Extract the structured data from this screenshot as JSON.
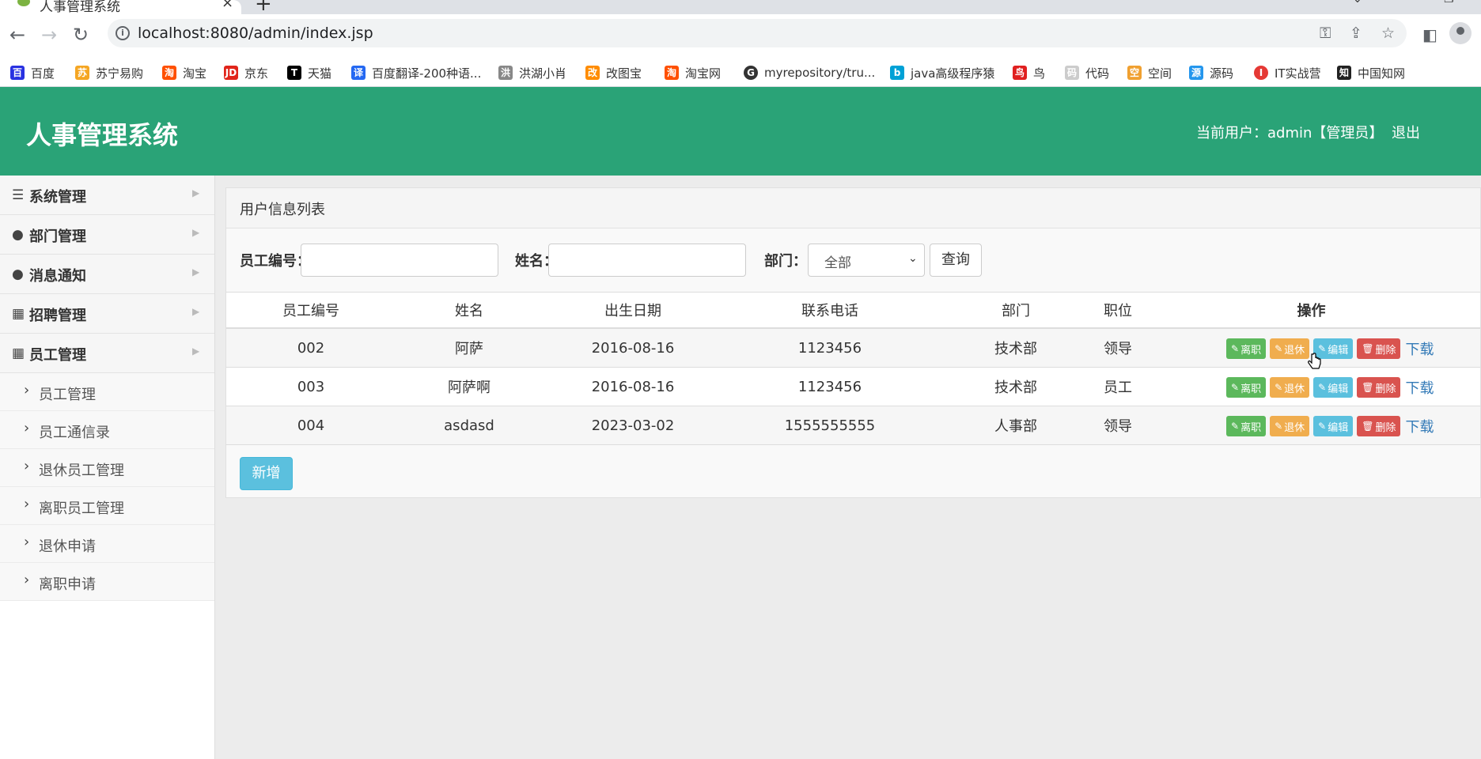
{
  "browser": {
    "tab_title": "人事管理系统",
    "url": "localhost:8080/admin/index.jsp",
    "bookmarks": [
      {
        "label": "百度",
        "icon": "baidu-icon",
        "color": "#2932e1"
      },
      {
        "label": "苏宁易购",
        "icon": "suning-icon",
        "color": "#f5a623"
      },
      {
        "label": "淘宝",
        "icon": "taobao-icon",
        "color": "#ff5000"
      },
      {
        "label": "京东",
        "icon": "jd-icon",
        "color": "#e1251b"
      },
      {
        "label": "天猫",
        "icon": "tmall-icon",
        "color": "#000000"
      },
      {
        "label": "百度翻译-200种语...",
        "icon": "baidu-translate-icon",
        "color": "#2468f2"
      },
      {
        "label": "洪湖小肖",
        "icon": "hongmeng-icon",
        "color": "#888888"
      },
      {
        "label": "改图宝",
        "icon": "gaitubao-icon",
        "color": "#ff8c00"
      },
      {
        "label": "淘宝网",
        "icon": "taobao-net-icon",
        "color": "#ff5000"
      },
      {
        "label": "myrepository/tru...",
        "icon": "github-icon",
        "color": "#333333"
      },
      {
        "label": "java高级程序猿",
        "icon": "bilibili-icon",
        "color": "#00a1d6"
      },
      {
        "label": "鸟",
        "icon": "bird-icon",
        "color": "#e02020"
      },
      {
        "label": "代码",
        "icon": "code-icon",
        "color": "#cccccc"
      },
      {
        "label": "空间",
        "icon": "qzone-icon",
        "color": "#f0a030"
      },
      {
        "label": "源码",
        "icon": "docker-icon",
        "color": "#2496ed"
      },
      {
        "label": "IT实战营",
        "icon": "chrome-red-icon",
        "color": "#e53935"
      },
      {
        "label": "中国知网",
        "icon": "cnki-icon",
        "color": "#222222"
      }
    ]
  },
  "header": {
    "title": "人事管理系统",
    "user_info": "当前用户：admin【管理员】",
    "logout": "退出",
    "color": "#2aa377"
  },
  "sidebar": {
    "menus": [
      {
        "label": "系统管理",
        "icon": "list-icon"
      },
      {
        "label": "部门管理",
        "icon": "user-icon"
      },
      {
        "label": "消息通知",
        "icon": "user-icon"
      },
      {
        "label": "招聘管理",
        "icon": "grid-icon"
      },
      {
        "label": "员工管理",
        "icon": "grid-icon"
      }
    ],
    "sub_items": [
      {
        "label": "员工管理"
      },
      {
        "label": "员工通信录"
      },
      {
        "label": "退休员工管理"
      },
      {
        "label": "离职员工管理"
      },
      {
        "label": "退休申请"
      },
      {
        "label": "离职申请"
      }
    ]
  },
  "main": {
    "panel_title": "用户信息列表",
    "filters": {
      "emp_no_label": "员工编号：",
      "emp_no_value": "",
      "name_label": "姓名：",
      "name_value": "",
      "dept_label": "部门：",
      "dept_selected": "全部",
      "query_button": "查询"
    },
    "columns": [
      "员工编号",
      "姓名",
      "出生日期",
      "联系电话",
      "部门",
      "职位",
      "操作"
    ],
    "rows": [
      {
        "emp_no": "002",
        "name": "阿萨",
        "birth": "2016-08-16",
        "phone": "1123456",
        "dept": "技术部",
        "position": "领导"
      },
      {
        "emp_no": "003",
        "name": "阿萨啊",
        "birth": "2016-08-16",
        "phone": "1123456",
        "dept": "技术部",
        "position": "员工"
      },
      {
        "emp_no": "004",
        "name": "asdasd",
        "birth": "2023-03-02",
        "phone": "1555555555",
        "dept": "人事部",
        "position": "领导"
      }
    ],
    "actions": {
      "resign": "离职",
      "retire": "退休",
      "edit": "编辑",
      "delete": "删除",
      "download": "下载"
    },
    "add_button": "新增"
  }
}
